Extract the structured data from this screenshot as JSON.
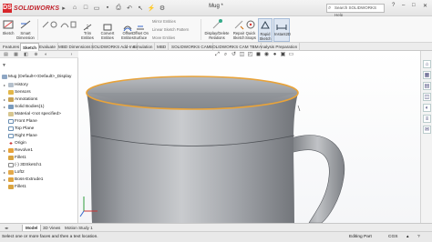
{
  "app": {
    "brand": "SOLIDWORKS",
    "title": "Mug *"
  },
  "search": {
    "placeholder": "Search SOLIDWORKS Help"
  },
  "quick_access": [
    "new-icon",
    "open-icon",
    "save-icon",
    "print-icon",
    "undo-icon",
    "select-icon",
    "rebuild-icon",
    "options-icon"
  ],
  "ribbon": {
    "sketch": "Sketch",
    "smart_dimension": "Smart Dimension",
    "trim": "Trim Entities",
    "convert": "Convert Entities",
    "offset": "Offset Entities",
    "offset_surface": "Offset On Surface",
    "mirror": "Mirror Entities",
    "linear_pattern": "Linear Sketch Pattern",
    "move": "Move Entities",
    "display_delete": "Display/Delete Relations",
    "repair": "Repair Sketch",
    "quick_snaps": "Quick Snaps",
    "rapid_sketch": "Rapid Sketch",
    "instant2d": "Instant2D"
  },
  "tabs": [
    "Features",
    "Sketch",
    "Evaluate",
    "MBD Dimensions",
    "SOLIDWORKS Add-Ins",
    "Simulation",
    "MBD",
    "SOLIDWORKS CAM",
    "SOLIDWORKS CAM TBM",
    "Analysis Preparation"
  ],
  "active_tab": "Sketch",
  "tree": {
    "root": "Mug (Default<<Default>_Display",
    "items": [
      "History",
      "Sensors",
      "Annotations",
      "Solid Bodies(1)",
      "Material <not specified>",
      "Front Plane",
      "Top Plane",
      "Right Plane",
      "Origin",
      "Revolve1",
      "Fillet1",
      "(-) 3DSketch1",
      "Loft2",
      "Boss-Extrude1",
      "Fillet1"
    ]
  },
  "bottom_tabs": [
    "Model",
    "3D Views",
    "Motion Study 1"
  ],
  "active_bottom_tab": "Model",
  "status": {
    "message": "Select one or more faces and then a text location.",
    "mode": "Editing Part",
    "units": "CGS"
  },
  "colors": {
    "accent": "#e8a33a",
    "brand": "#d7262b",
    "body": "#8e9196"
  }
}
